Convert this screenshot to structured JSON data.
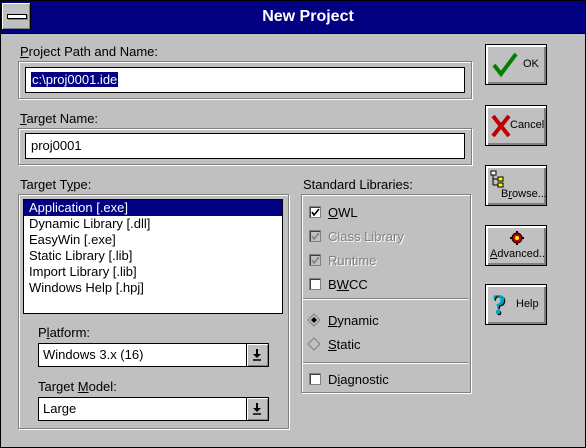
{
  "window": {
    "title": "New Project"
  },
  "project_path": {
    "label_u": "P",
    "label_rest": "roject Path and Name:",
    "value": "c:\\proj0001.ide"
  },
  "target_name": {
    "label_u": "T",
    "label_rest": "arget Name:",
    "value": "proj0001"
  },
  "target_type": {
    "label_pre": "Target T",
    "label_u": "y",
    "label_rest": "pe:",
    "items": [
      "Application [.exe]",
      "Dynamic Library [.dll]",
      "EasyWin [.exe]",
      "Static Library [.lib]",
      "Import Library [.lib]",
      "Windows Help [.hpj]"
    ],
    "selected_index": 0
  },
  "platform": {
    "label_pre": "P",
    "label_u": "l",
    "label_rest": "atform:",
    "value": "Windows 3.x (16)"
  },
  "target_model": {
    "label_pre": "Target ",
    "label_u": "M",
    "label_rest": "odel:",
    "value": "Large"
  },
  "standard_libraries": {
    "label": "Standard Libraries:",
    "owl": {
      "label_u": "O",
      "label_rest": "WL",
      "checked": true
    },
    "class_library": {
      "label": "Class Library",
      "checked": true,
      "enabled": false
    },
    "runtime": {
      "label": "Runtime",
      "checked": true,
      "enabled": false
    },
    "bwcc": {
      "label_pre": "B",
      "label_u": "W",
      "label_rest": "CC",
      "checked": false
    },
    "dynamic": {
      "label_u": "D",
      "label_rest": "ynamic",
      "selected": true
    },
    "static": {
      "label_u": "S",
      "label_rest": "tatic",
      "selected": false,
      "enabled": false
    },
    "diagnostic": {
      "label_pre": "D",
      "label_u": "i",
      "label_rest": "agnostic",
      "checked": false
    }
  },
  "buttons": {
    "ok": "OK",
    "cancel": "Cancel",
    "browse_pre": "B",
    "browse_u": "r",
    "browse_rest": "owse...",
    "advanced_pre": "",
    "advanced_u": "A",
    "advanced_rest": "dvanced...",
    "help": "Help"
  },
  "colors": {
    "titlebar": "#000080",
    "face": "#c0c0c0",
    "selection": "#000080",
    "ok_check": "#008000",
    "cancel_x": "#c00000"
  },
  "icons": {
    "ok": "green-check-icon",
    "cancel": "red-x-icon",
    "browse": "tree-icon",
    "advanced": "gears-icon",
    "help": "question-mark-icon"
  }
}
